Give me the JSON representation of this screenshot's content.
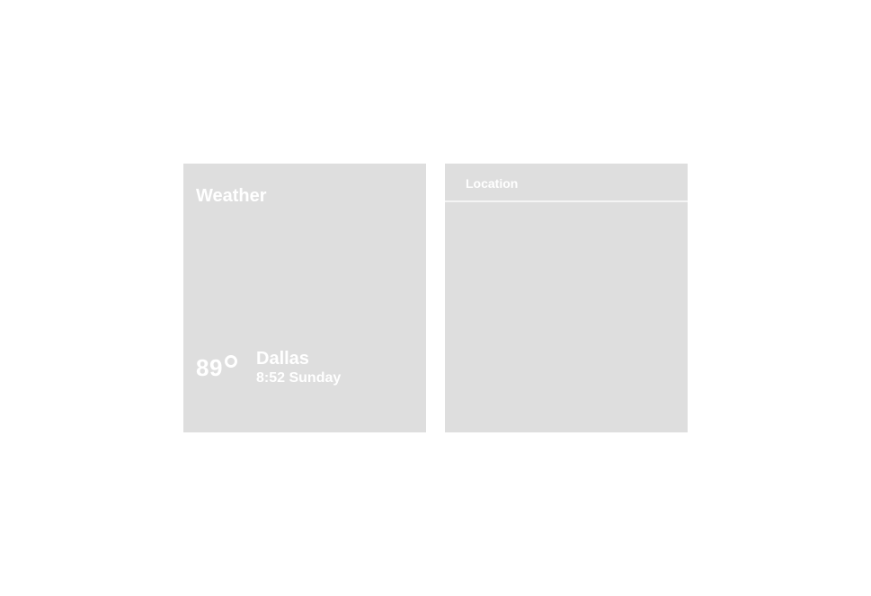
{
  "weather": {
    "title": "Weather",
    "temperature": "89",
    "degree_icon": "degree-circle-icon",
    "city": "Dallas",
    "datetime": "8:52 Sunday"
  },
  "location": {
    "title": "Location"
  },
  "colors": {
    "card_background": "#dedede",
    "text": "#ffffff",
    "divider": "#f4f4f4",
    "page_background": "#ffffff"
  }
}
